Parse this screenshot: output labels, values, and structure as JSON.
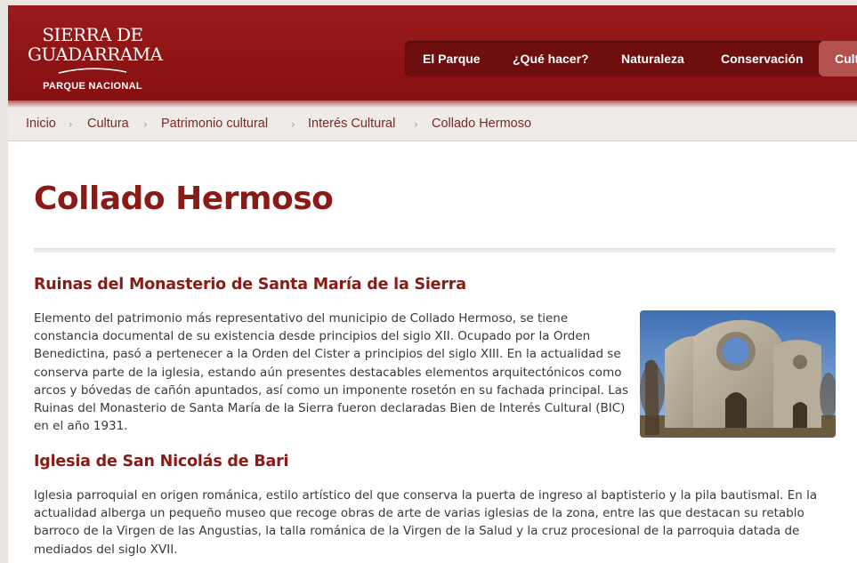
{
  "header": {
    "logo": {
      "line1": "SIERRA DE",
      "line2": "GUADARRAMA",
      "subtitle": "PARQUE NACIONAL"
    },
    "nav": [
      {
        "label": "El Parque"
      },
      {
        "label": "¿Qué hacer?"
      },
      {
        "label": "Naturaleza"
      },
      {
        "label": "Conservación"
      },
      {
        "label": "Cultura"
      }
    ]
  },
  "breadcrumb": [
    "Inicio",
    "Cultura",
    "Patrimonio cultural",
    "Interés Cultural",
    "Collado Hermoso"
  ],
  "page": {
    "title": "Collado Hermoso",
    "sections": [
      {
        "heading": "Ruinas del Monasterio de Santa María de la Sierra",
        "body_lines": [
          "Elemento del patrimonio más representativo del municipio de Collado Hermoso, se tiene",
          "constancia documental de su existencia desde principios del siglo XII. Ocupado por la Orden",
          "Benedictina, pasó a pertenecer a la Orden del Cister a principios del siglo XIII. En la actualidad se",
          "conserva parte de la iglesia, estando aún presentes destacables elementos arquitectónicos como",
          "arcos y bóvedas de cañón apuntados, así como un imponente rosetón en su fachada principal. Las",
          "Ruinas del Monasterio de Santa María de la Sierra fueron declaradas Bien de Interés Cultural (BIC)",
          "en el año 1931."
        ]
      },
      {
        "heading": "Iglesia de San Nicolás de Bari",
        "body_lines": [
          "Iglesia parroquial en origen románica, estilo artístico del que conserva la puerta de ingreso al baptisterio y la pila bautismal. En la",
          "actualidad alberga un pequeño museo que recoge obras de arte de varias iglesias de la zona, entre las que destacan su retablo",
          "barroco de la Virgen de las Angustias, la talla románica de la Virgen de la Salud y la cruz procesional de la parroquia datada de",
          "mediados del siglo XVII."
        ]
      }
    ]
  },
  "colors": {
    "brand_red": "#8a1313",
    "title_red": "#8a1a16",
    "breadcrumb_text": "#7a2a25",
    "active_nav": "#b3514f"
  }
}
